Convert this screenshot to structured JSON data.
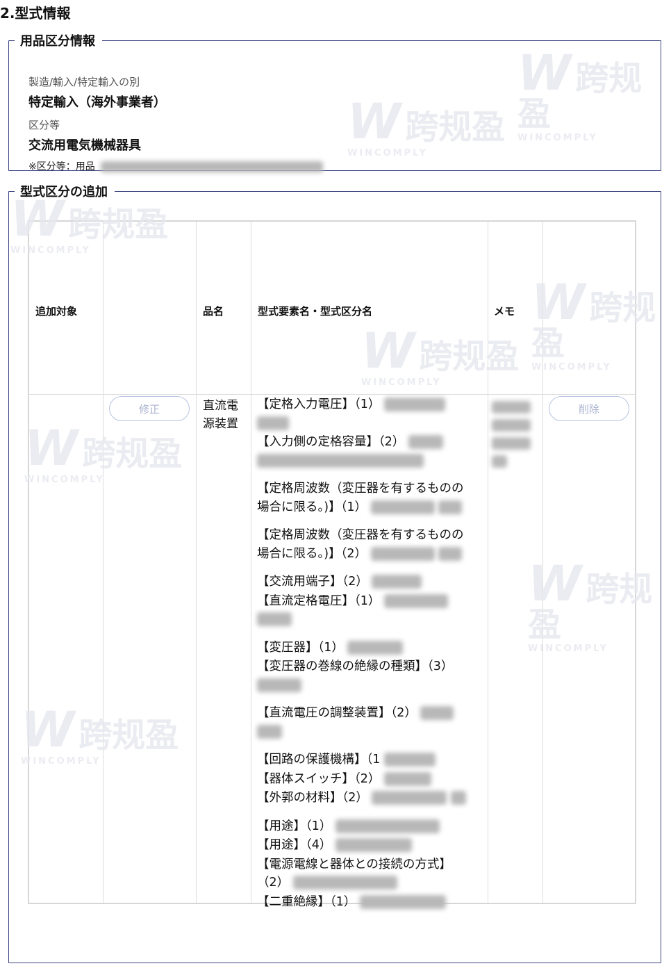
{
  "section": {
    "title": "2.型式情報"
  },
  "product_category": {
    "legend": "用品区分情報",
    "manufacture_label": "製造/輸入/特定輸入の別",
    "manufacture_value": "特定輸入（海外事業者）",
    "category_label": "区分等",
    "category_value": "交流用電気機械器具",
    "note_prefix": "※区分等：用品"
  },
  "model_addition": {
    "legend": "型式区分の追加",
    "headers": {
      "target": "追加対象",
      "product_name": "品名",
      "model_elements": "型式要素名・型式区分名",
      "memo": "メモ"
    },
    "row": {
      "edit_label": "修正",
      "product_name": "直流電源装置",
      "delete_label": "削除",
      "specs": [
        "【定格入力電圧】（1）",
        "【入力側の定格容量】（2）",
        "【定格周波数（変圧器を有するものの場合に限る。)】（1）",
        "【定格周波数（変圧器を有するものの場合に限る。)】（2）",
        "【交流用端子】（2）",
        "【直流定格電圧】（1）",
        "【変圧器】（1）",
        "【変圧器の巻線の絶縁の種類】（3）",
        "【直流電圧の調整装置】（2）",
        "【回路の保護機構】（1",
        "【器体スイッチ】（2）",
        "【外郭の材料】（2）",
        "【用途】（1）",
        "【用途】（4）",
        "【電源電線と器体との接続の方式】（2）",
        "【二重絶縁】（1）"
      ]
    }
  },
  "watermark": {
    "cn": "跨规盈",
    "en": "WINCOMPLY"
  }
}
